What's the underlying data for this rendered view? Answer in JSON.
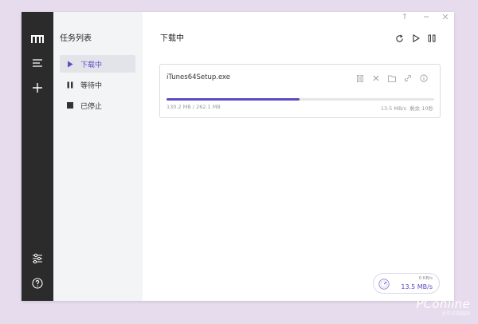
{
  "sidebar": {
    "icons": [
      "logo-icon",
      "menu-icon",
      "add-icon",
      "settings-icon",
      "help-icon"
    ]
  },
  "tasklist": {
    "title": "任务列表",
    "items": [
      {
        "label": "下载中",
        "icon": "play-icon",
        "active": true
      },
      {
        "label": "等待中",
        "icon": "pause-icon",
        "active": false
      },
      {
        "label": "已停止",
        "icon": "stop-icon",
        "active": false
      }
    ]
  },
  "main": {
    "title": "下载中",
    "window_controls": [
      "pin-icon",
      "minimize-icon",
      "close-icon"
    ],
    "header_icons": [
      "refresh-icon",
      "resume-all-icon",
      "pause-all-icon"
    ]
  },
  "task": {
    "filename": "iTunes64Setup.exe",
    "size_text": "130.2 MB / 262.1 MB",
    "speed_text": "13.5 MB/s",
    "remaining_text": "剩余 10秒",
    "progress": 0.497,
    "actions": [
      "pause-icon",
      "delete-icon",
      "folder-icon",
      "link-icon",
      "info-icon"
    ]
  },
  "speed_widget": {
    "upload": "0 KB/s",
    "download": "13.5 MB/s"
  },
  "watermark": {
    "logo": "PConline",
    "sub": "太平洋电脑网"
  },
  "colors": {
    "accent": "#5b4cc4",
    "sidebar_bg": "#2b2b2b",
    "tasklist_bg": "#f3f4f6",
    "page_bg": "#e7dcee"
  }
}
